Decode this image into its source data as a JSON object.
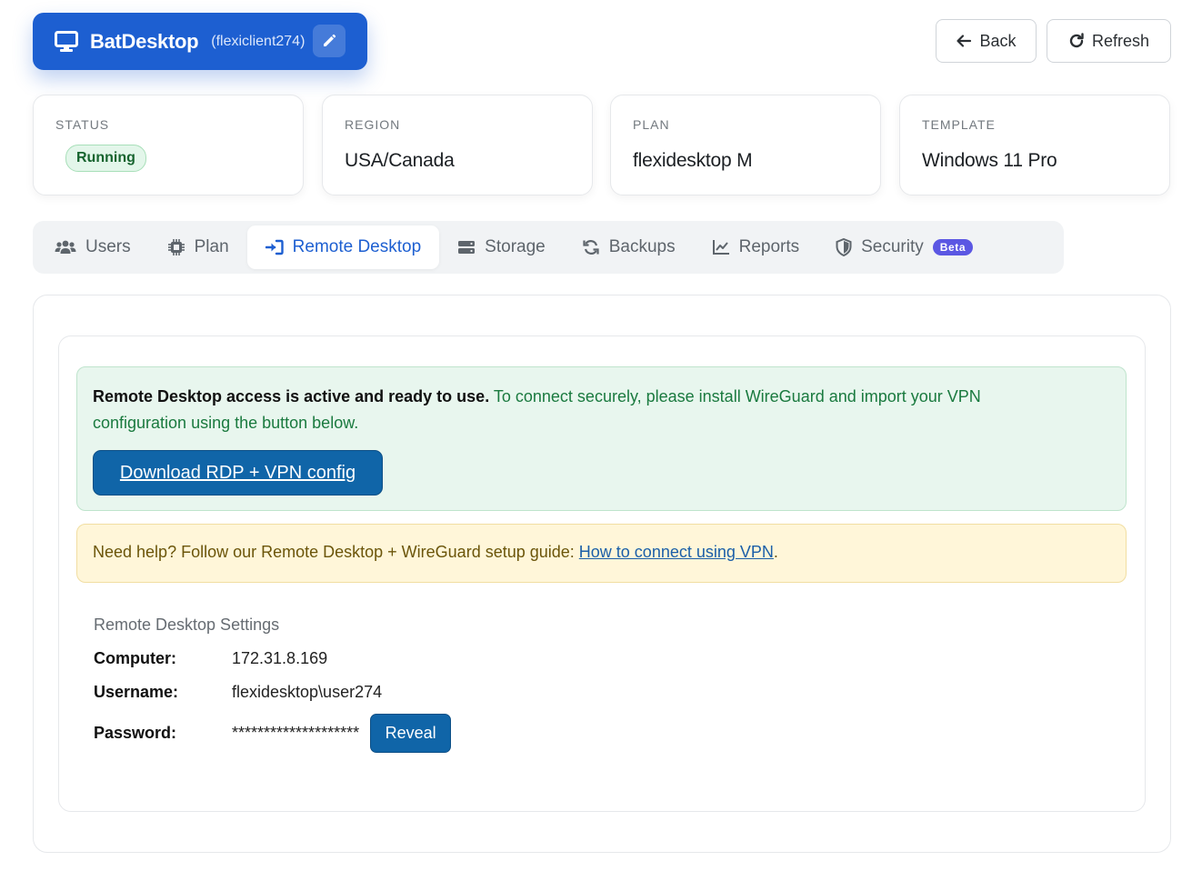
{
  "header": {
    "app_name": "BatDesktop",
    "client": "(flexiclient274)",
    "back_label": "Back",
    "refresh_label": "Refresh"
  },
  "cards": [
    {
      "label": "STATUS",
      "value": "Running"
    },
    {
      "label": "REGION",
      "value": "USA/Canada"
    },
    {
      "label": "PLAN",
      "value": "flexidesktop M"
    },
    {
      "label": "TEMPLATE",
      "value": "Windows 11 Pro"
    }
  ],
  "tabs": [
    {
      "label": "Users",
      "icon": "users-icon"
    },
    {
      "label": "Plan",
      "icon": "chip-icon"
    },
    {
      "label": "Remote Desktop",
      "icon": "sign-in-icon",
      "active": true
    },
    {
      "label": "Storage",
      "icon": "hard-drive-icon"
    },
    {
      "label": "Backups",
      "icon": "sync-icon"
    },
    {
      "label": "Reports",
      "icon": "line-chart-icon"
    },
    {
      "label": "Security",
      "icon": "shield-icon",
      "badge": "Beta"
    }
  ],
  "remote": {
    "alert_bold": "Remote Desktop access is active and ready to use.",
    "alert_text": " To connect securely, please install WireGuard and import your VPN configuration using the button below.",
    "download_label": "Download RDP + VPN config",
    "help_text": "Need help? Follow our Remote Desktop + WireGuard setup guide: ",
    "help_link": "How to connect using VPN",
    "help_suffix": ".",
    "settings_title": "Remote Desktop Settings",
    "computer_label": "Computer:",
    "computer_value": "172.31.8.169",
    "username_label": "Username:",
    "username_value": "flexidesktop\\user274",
    "password_label": "Password:",
    "password_value": "********************",
    "reveal_label": "Reveal"
  },
  "colors": {
    "primary": "#1d5fd1",
    "button": "#1065a8",
    "success_bg": "#e8f6ee",
    "warning_bg": "#fff6d9",
    "beta": "#5b57e3"
  }
}
